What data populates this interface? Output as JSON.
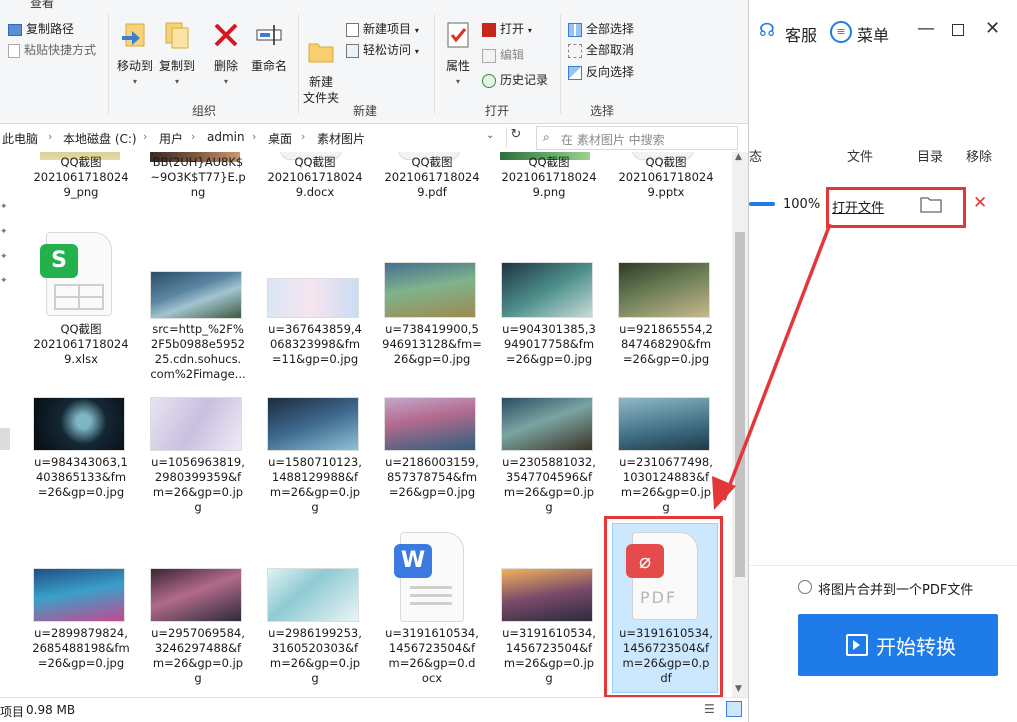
{
  "ribbon": {
    "top_tab": "查看",
    "clipboard": {
      "copy_path": "复制路径",
      "paste_shortcut": "粘贴快捷方式"
    },
    "organize": {
      "label": "组织",
      "move_to": "移动到",
      "copy_to": "复制到",
      "delete": "删除",
      "rename": "重命名"
    },
    "new": {
      "label": "新建",
      "new_folder": "新建\n文件夹",
      "new_item": "新建项目",
      "easy_access": "轻松访问"
    },
    "open": {
      "label": "打开",
      "properties": "属性",
      "open": "打开",
      "edit": "编辑",
      "history": "历史记录"
    },
    "select": {
      "label": "选择",
      "select_all": "全部选择",
      "select_none": "全部取消",
      "invert": "反向选择"
    }
  },
  "address": {
    "crumbs": [
      "此电脑",
      "本地磁盘 (C:)",
      "用户",
      "admin",
      "桌面",
      "素材图片"
    ],
    "search_placeholder": "在 素材图片 中搜索"
  },
  "files": {
    "row0": [
      {
        "name": "QQ截图\n2021061718024\n9_png"
      },
      {
        "name": "BB(2UH}AU8K$\n~9O3K$T77}E.p\nng"
      },
      {
        "name": "QQ截图\n2021061718024\n9.docx"
      },
      {
        "name": "QQ截图\n2021061718024\n9.pdf"
      },
      {
        "name": "QQ截图\n2021061718024\n9.png"
      },
      {
        "name": "QQ截图\n2021061718024\n9.pptx"
      }
    ],
    "row1": [
      {
        "name": "QQ截图\n2021061718024\n9.xlsx"
      },
      {
        "name": "src=http_%2F%\n2F5b0988e5952\n25.cdn.sohucs.\ncom%2Fimage..."
      },
      {
        "name": "u=367643859,4\n068323998&fm\n=11&gp=0.jpg"
      },
      {
        "name": "u=738419900,5\n946913128&fm=\n26&gp=0.jpg"
      },
      {
        "name": "u=904301385,3\n949017758&fm\n=26&gp=0.jpg"
      },
      {
        "name": "u=921865554,2\n847468290&fm\n=26&gp=0.jpg"
      }
    ],
    "row2": [
      {
        "name": "u=984343063,1\n403865133&fm\n=26&gp=0.jpg"
      },
      {
        "name": "u=1056963819,\n2980399359&f\nm=26&gp=0.jp\ng"
      },
      {
        "name": "u=1580710123,\n1488129988&f\nm=26&gp=0.jp\ng"
      },
      {
        "name": "u=2186003159,\n857378754&fm\n=26&gp=0.jpg"
      },
      {
        "name": "u=2305881032,\n3547704596&f\nm=26&gp=0.jp\ng"
      },
      {
        "name": "u=2310677498,\n1030124883&f\nm=26&gp=0.jp\ng"
      }
    ],
    "row3": [
      {
        "name": "u=2899879824,\n2685488198&fm\n=26&gp=0.jpg"
      },
      {
        "name": "u=2957069584,\n3246297488&f\nm=26&gp=0.jp\ng"
      },
      {
        "name": "u=2986199253,\n3160520303&f\nm=26&gp=0.jp\ng"
      },
      {
        "name": "u=3191610534,\n1456723504&f\nm=26&gp=0.d\nocx"
      },
      {
        "name": "u=3191610534,\n1456723504&f\nm=26&gp=0.jp\ng"
      },
      {
        "name": "u=3191610534,\n1456723504&f\nm=26&gp=0.p\ndf"
      }
    ],
    "xlsx_badge": "S",
    "word_badge": "W",
    "pdf_text": "PDF"
  },
  "status": {
    "items": "项目",
    "size": "0.98 MB"
  },
  "app": {
    "service": "客服",
    "menu": "菜单",
    "col_status": "态",
    "col_file": "文件",
    "col_dir": "目录",
    "col_remove": "移除",
    "progress": "100%",
    "progress_value": 1.0,
    "open_file": "打开文件",
    "merge_option": "将图片合并到一个PDF文件",
    "start": "开始转换"
  },
  "colors": {
    "accent": "#1f7be8",
    "highlight": "#e43838",
    "selected_bg": "#cce8ff"
  }
}
